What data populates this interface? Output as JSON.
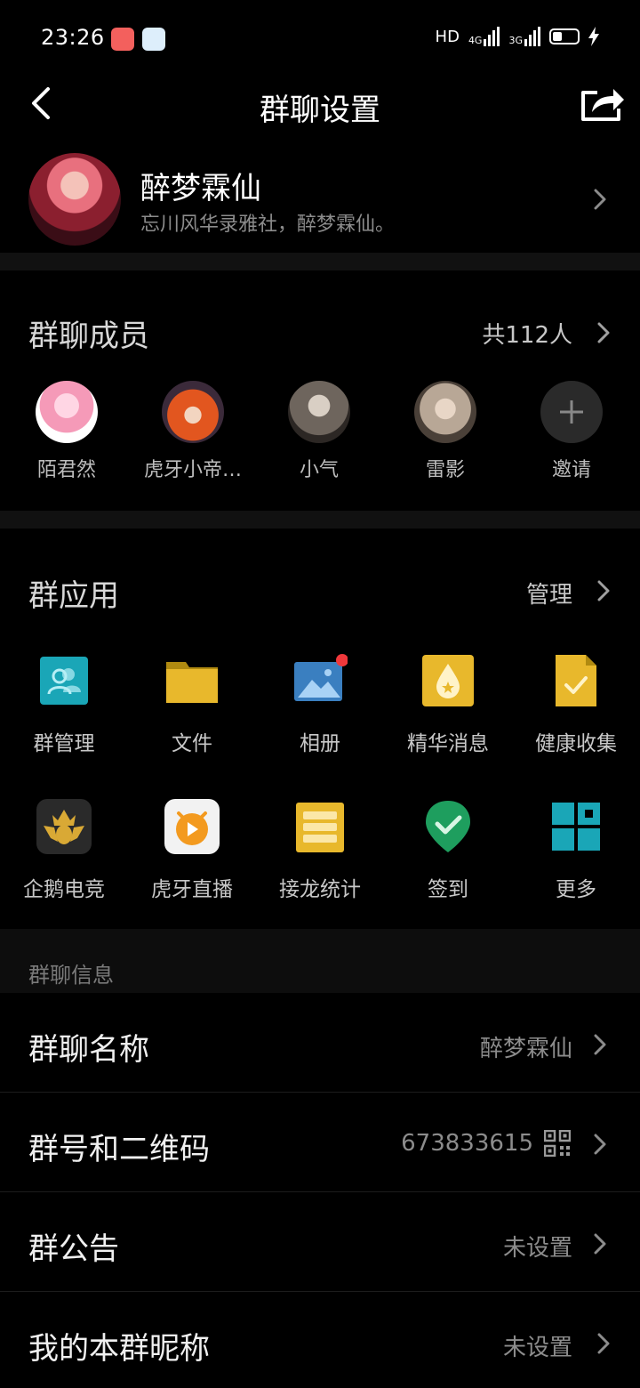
{
  "status_bar": {
    "time": "23:26",
    "network_hd": "HD",
    "network_4g": "4G",
    "network_3g": "3G"
  },
  "header": {
    "title": "群聊设置"
  },
  "profile": {
    "name": "醉梦霖仙",
    "description": "忘川风华录雅社，醉梦霖仙。"
  },
  "members": {
    "title": "群聊成员",
    "count": "共112人",
    "items": [
      {
        "name": "陌君然"
      },
      {
        "name": "虎牙小帝…"
      },
      {
        "name": "小气"
      },
      {
        "name": "雷影"
      },
      {
        "name": "邀请"
      }
    ]
  },
  "apps": {
    "title": "群应用",
    "manage": "管理",
    "items": [
      {
        "label": "群管理",
        "icon": "group-manage-icon"
      },
      {
        "label": "文件",
        "icon": "folder-icon"
      },
      {
        "label": "相册",
        "icon": "photo-album-icon"
      },
      {
        "label": "精华消息",
        "icon": "featured-message-icon"
      },
      {
        "label": "健康收集",
        "icon": "health-collect-icon"
      },
      {
        "label": "企鹅电竞",
        "icon": "penguin-esports-icon"
      },
      {
        "label": "虎牙直播",
        "icon": "huya-live-icon"
      },
      {
        "label": "接龙统计",
        "icon": "chain-stats-icon"
      },
      {
        "label": "签到",
        "icon": "check-in-icon"
      },
      {
        "label": "更多",
        "icon": "more-apps-icon"
      }
    ]
  },
  "info": {
    "section_title": "群聊信息",
    "rows": [
      {
        "label": "群聊名称",
        "value": "醉梦霖仙"
      },
      {
        "label": "群号和二维码",
        "value": "673833615"
      },
      {
        "label": "群公告",
        "value": "未设置"
      },
      {
        "label": "我的本群昵称",
        "value": "未设置"
      }
    ]
  },
  "colors": {
    "background": "#000000",
    "band": "#111111",
    "notification_dot": "#f0383b",
    "teal": "#1aa6b7",
    "gold": "#e8b82c"
  }
}
